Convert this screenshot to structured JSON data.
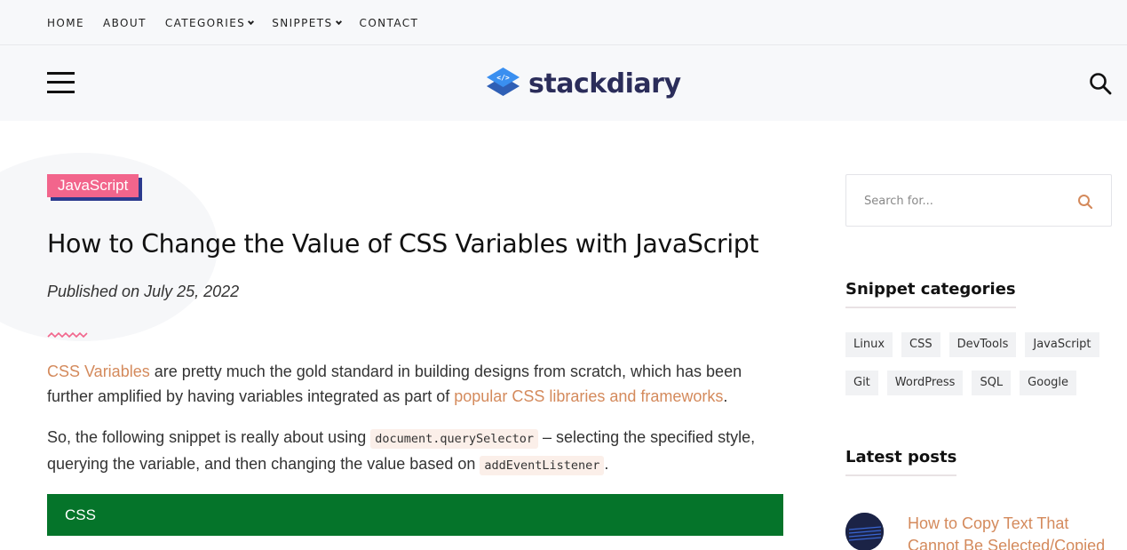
{
  "topnav": {
    "items": [
      {
        "label": "HOME",
        "dropdown": false
      },
      {
        "label": "ABOUT",
        "dropdown": false
      },
      {
        "label": "CATEGORIES",
        "dropdown": true
      },
      {
        "label": "SNIPPETS",
        "dropdown": true
      },
      {
        "label": "CONTACT",
        "dropdown": false
      }
    ]
  },
  "header": {
    "logo_text": "stackdiary",
    "brand_color": "#2b2d5a",
    "logo_accent_color": "#3a7bd5"
  },
  "article": {
    "category_badge": "JavaScript",
    "title": "How to Change the Value of CSS Variables with JavaScript",
    "published": "Published on July 25, 2022",
    "para1": {
      "link1": "CSS Variables",
      "text1": " are pretty much the gold standard in building designs from scratch, which has been further amplified by having variables integrated as part of ",
      "link2": "popular CSS libraries and frameworks",
      "text2": "."
    },
    "para2": {
      "text1": "So, the following snippet is really about using ",
      "code1": "document.querySelector",
      "text2": " – selecting the specified style, querying the variable, and then changing the value based on ",
      "code2": "addEventListener",
      "text3": "."
    },
    "code_block_label": "CSS"
  },
  "sidebar": {
    "search_placeholder": "Search for...",
    "categories_heading": "Snippet categories",
    "categories": [
      "Linux",
      "CSS",
      "DevTools",
      "JavaScript",
      "Git",
      "WordPress",
      "SQL",
      "Google"
    ],
    "latest_heading": "Latest posts",
    "latest_posts": [
      {
        "title": "How to Copy Text That Cannot Be Selected/Copied"
      }
    ]
  },
  "colors": {
    "badge": "#f2658c",
    "badge_shadow": "#2b3a8e",
    "link": "#d48a5c",
    "code_bar": "#05742a"
  }
}
